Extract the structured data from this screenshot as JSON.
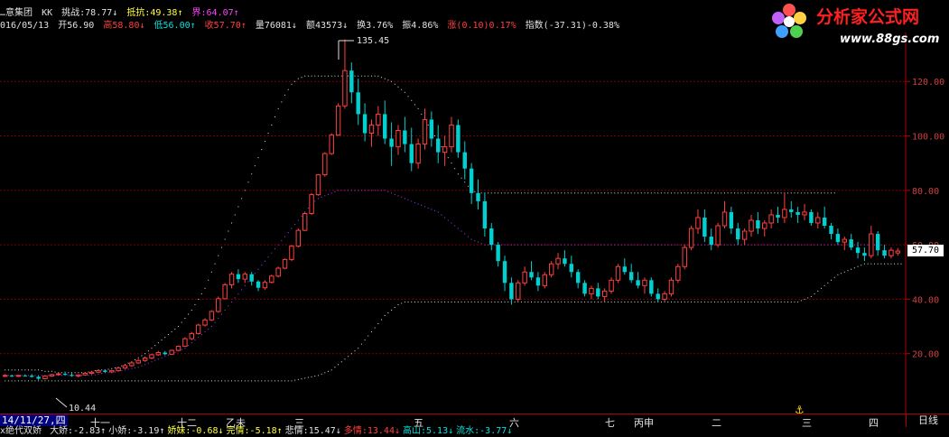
{
  "header": {
    "stock_name": "…意集团",
    "indicator_name": "KK",
    "tiaozhan": "挑战:78.77↓",
    "kangli": "抵抗:49.38↑",
    "jie": "界:64.07↑",
    "date": "016/05/13",
    "open": "开56.90",
    "high": "高58.80↓",
    "low": "低56.00↑",
    "close": "收57.70↑",
    "volume": "量76081↓",
    "amount": "额43573↓",
    "turnover": "换3.76%",
    "amplitude": "振4.86%",
    "change": "涨(0.10)0.17%",
    "index": "指数(-37.31)-0.38%"
  },
  "watermark": {
    "brand": "分析家公式网",
    "url": "www.88gs.com",
    "colors": {
      "brand": "#ff2020",
      "url": "#ffffff"
    }
  },
  "annotations": {
    "peak": "135.45",
    "trough": "10.44",
    "current_price": "57.70"
  },
  "y_axis": {
    "labels": [
      "120.00",
      "100.00",
      "80.00",
      "60.00",
      "40.00",
      "20.00"
    ]
  },
  "time_axis": {
    "date_box": "14/11/27,四",
    "labels": [
      "十一",
      "十二",
      "乙未",
      "三",
      "五",
      "六",
      "七",
      "丙申",
      "二",
      "三",
      "四"
    ],
    "period_button": "日线"
  },
  "footer": {
    "prefix": "x绝代双娇",
    "items": [
      {
        "label": "大娇:-2.83↑",
        "color": "#e0e0e0"
      },
      {
        "label": "小娇:-3.19↑",
        "color": "#e0e0e0"
      },
      {
        "label": "娇妹:-0.68↓",
        "color": "#ffff40"
      },
      {
        "label": "完情:-5.18↑",
        "color": "#ffff40"
      },
      {
        "label": "悲情:15.47↓",
        "color": "#e0e0e0"
      },
      {
        "label": "多情:13.44↓",
        "color": "#ff4040"
      },
      {
        "label": "高山:5.13↓",
        "color": "#00e0e0"
      },
      {
        "label": "流水:-3.77↓",
        "color": "#00e0e0"
      }
    ]
  },
  "chart_data": {
    "type": "candlestick",
    "ylim": [
      0,
      135
    ],
    "gridlines": [
      20,
      40,
      60,
      80,
      100,
      120
    ],
    "candles": [
      [
        12,
        12.5,
        11.5,
        12
      ],
      [
        12,
        12.3,
        11.4,
        11.8
      ],
      [
        11.8,
        12.2,
        11.5,
        12
      ],
      [
        12,
        12.4,
        11.6,
        11.9
      ],
      [
        11.9,
        12.5,
        11.2,
        11.5
      ],
      [
        11.5,
        11.8,
        10.4,
        10.8
      ],
      [
        10.8,
        12,
        10.6,
        11.8
      ],
      [
        11.8,
        12.6,
        11.5,
        12.3
      ],
      [
        12.3,
        13,
        12,
        12.6
      ],
      [
        12.6,
        13.4,
        12.2,
        12.2
      ],
      [
        12.2,
        12.8,
        11.5,
        11.8
      ],
      [
        11.8,
        12.4,
        11.3,
        12.2
      ],
      [
        12.2,
        13,
        12,
        12.8
      ],
      [
        12.8,
        13.6,
        12.4,
        13.2
      ],
      [
        13.2,
        14,
        12.9,
        13.8
      ],
      [
        13.8,
        14.2,
        13,
        13.3
      ],
      [
        13.3,
        14,
        13,
        13.8
      ],
      [
        13.8,
        15,
        13.6,
        14.7
      ],
      [
        14.7,
        16,
        14.4,
        15.6
      ],
      [
        15.6,
        17,
        15.2,
        16.6
      ],
      [
        16.6,
        18,
        16.2,
        17.5
      ],
      [
        17.5,
        19,
        17,
        18.4
      ],
      [
        18.4,
        20,
        18,
        19.6
      ],
      [
        19.6,
        21,
        19.2,
        20.4
      ],
      [
        20.4,
        21,
        19.4,
        19.8
      ],
      [
        19.8,
        21.5,
        19.5,
        21.2
      ],
      [
        21.2,
        23,
        21,
        22.7
      ],
      [
        22.7,
        26,
        22.5,
        25.5
      ],
      [
        25.5,
        28,
        25,
        27.4
      ],
      [
        27.4,
        31,
        27,
        30.5
      ],
      [
        30.5,
        33,
        30,
        32.4
      ],
      [
        32.4,
        36,
        32,
        35.5
      ],
      [
        35.5,
        41,
        35,
        40.2
      ],
      [
        40.2,
        46,
        40,
        45.3
      ],
      [
        45.3,
        50,
        44,
        49.2
      ],
      [
        49.2,
        51,
        46,
        47.4
      ],
      [
        47.4,
        50,
        46,
        49.2
      ],
      [
        49.2,
        50,
        45,
        46.5
      ],
      [
        46.5,
        47,
        43,
        44.2
      ],
      [
        44.2,
        47,
        43.5,
        46.2
      ],
      [
        46.2,
        49,
        45.8,
        48.5
      ],
      [
        48.5,
        52,
        48,
        51.4
      ],
      [
        51.4,
        55,
        51,
        54.6
      ],
      [
        54.6,
        60,
        54,
        59.5
      ],
      [
        59.5,
        66,
        59,
        65.3
      ],
      [
        65.3,
        72,
        65,
        71.5
      ],
      [
        71.5,
        79,
        71,
        78.4
      ],
      [
        78.4,
        86,
        78,
        85.7
      ],
      [
        85.7,
        94,
        85,
        93.5
      ],
      [
        93.5,
        101,
        93,
        100.3
      ],
      [
        100.3,
        112,
        100,
        111
      ],
      [
        111,
        135.45,
        110,
        124
      ],
      [
        124,
        127,
        112,
        116
      ],
      [
        116,
        121,
        104,
        108
      ],
      [
        108,
        112,
        98,
        101
      ],
      [
        101,
        106,
        96,
        104
      ],
      [
        104,
        111,
        100,
        108
      ],
      [
        108,
        113,
        97,
        99
      ],
      [
        99,
        105,
        89,
        96
      ],
      [
        96,
        104,
        93,
        102
      ],
      [
        102,
        107,
        94,
        97
      ],
      [
        97,
        103,
        87,
        90
      ],
      [
        90,
        99,
        88,
        97
      ],
      [
        97,
        110,
        95,
        106
      ],
      [
        106,
        109,
        96,
        99
      ],
      [
        99,
        104,
        90,
        94
      ],
      [
        94,
        100,
        89,
        96
      ],
      [
        96,
        107,
        94,
        104
      ],
      [
        104,
        106,
        92,
        94
      ],
      [
        94,
        98,
        84,
        88
      ],
      [
        88,
        90,
        75,
        79
      ],
      [
        79,
        84,
        73,
        76
      ],
      [
        76,
        79,
        63,
        66
      ],
      [
        66,
        68,
        58,
        60
      ],
      [
        60,
        61,
        52,
        54
      ],
      [
        54,
        56,
        43,
        46
      ],
      [
        46,
        48,
        38,
        40
      ],
      [
        40,
        47,
        39,
        46
      ],
      [
        46,
        52,
        45,
        50
      ],
      [
        50,
        54,
        47,
        48
      ],
      [
        48,
        50,
        43,
        45
      ],
      [
        45,
        50,
        44,
        49
      ],
      [
        49,
        54,
        48,
        53
      ],
      [
        53,
        57,
        51,
        55
      ],
      [
        55,
        58,
        52,
        53
      ],
      [
        53,
        56,
        48,
        50
      ],
      [
        50,
        51,
        44,
        46
      ],
      [
        46,
        47,
        41,
        42
      ],
      [
        42,
        45,
        40,
        44
      ],
      [
        44,
        46,
        40,
        41
      ],
      [
        41,
        44,
        39,
        43
      ],
      [
        43,
        48,
        42,
        47
      ],
      [
        47,
        53,
        46,
        52
      ],
      [
        52,
        55,
        49,
        50
      ],
      [
        50,
        53,
        46,
        47
      ],
      [
        47,
        50,
        44,
        45
      ],
      [
        45,
        48,
        42,
        47
      ],
      [
        47,
        48,
        41,
        42
      ],
      [
        42,
        44,
        39,
        40
      ],
      [
        40,
        43,
        39,
        42
      ],
      [
        42,
        48,
        41,
        47
      ],
      [
        47,
        53,
        46,
        52
      ],
      [
        52,
        60,
        51,
        59
      ],
      [
        59,
        67,
        58,
        66
      ],
      [
        66,
        73,
        64,
        70
      ],
      [
        70,
        73,
        61,
        63
      ],
      [
        63,
        66,
        58,
        60
      ],
      [
        60,
        68,
        59,
        67
      ],
      [
        67,
        76,
        66,
        72
      ],
      [
        72,
        74,
        64,
        66
      ],
      [
        66,
        68,
        60,
        62
      ],
      [
        62,
        66,
        60,
        65
      ],
      [
        65,
        71,
        63,
        69
      ],
      [
        69,
        72,
        64,
        66
      ],
      [
        66,
        69,
        63,
        68
      ],
      [
        68,
        73,
        66,
        71
      ],
      [
        71,
        74,
        68,
        70
      ],
      [
        70,
        79,
        68,
        73
      ],
      [
        73,
        76,
        70,
        72
      ],
      [
        72,
        74,
        68,
        71
      ],
      [
        71,
        75,
        69,
        72
      ],
      [
        72,
        73,
        67,
        68
      ],
      [
        68,
        72,
        66,
        70
      ],
      [
        70,
        74,
        66,
        67
      ],
      [
        67,
        68,
        62,
        64
      ],
      [
        64,
        66,
        60,
        61
      ],
      [
        61,
        63,
        58,
        62
      ],
      [
        62,
        64,
        58,
        59
      ],
      [
        59,
        61,
        55,
        57
      ],
      [
        57,
        59,
        54,
        56
      ],
      [
        56,
        67,
        55,
        64
      ],
      [
        64,
        65,
        56,
        58
      ],
      [
        58,
        60,
        55,
        56
      ],
      [
        56,
        59,
        55,
        58
      ],
      [
        57,
        58.8,
        56,
        57.7
      ]
    ],
    "upper_band": [
      14,
      14,
      14,
      14,
      14,
      14,
      13.5,
      13.5,
      13,
      13,
      13,
      13,
      13,
      13.5,
      14,
      14,
      14.5,
      15,
      16,
      17,
      18.5,
      20,
      22,
      24,
      26,
      28,
      30,
      33,
      36,
      40,
      44,
      50,
      56,
      62,
      68,
      74,
      80,
      86,
      92,
      98,
      104,
      110,
      115,
      119,
      121,
      122,
      122,
      122,
      122,
      122,
      122,
      122,
      122,
      122,
      122,
      122,
      122,
      121,
      120,
      118,
      116,
      113,
      110,
      106,
      102,
      98,
      94,
      90,
      86,
      83,
      80,
      79,
      79,
      79,
      79,
      79,
      79,
      79,
      79,
      79,
      79,
      79,
      79,
      79,
      79,
      79,
      79,
      79,
      79,
      79,
      79,
      79,
      79,
      79,
      79,
      79,
      79,
      79,
      79,
      79,
      79,
      79,
      79,
      79,
      79,
      79,
      79,
      79,
      79,
      79,
      79,
      79,
      79,
      79,
      79,
      79,
      79,
      79,
      79,
      79,
      79,
      79,
      79,
      79,
      79
    ],
    "mid_band": [
      12,
      12,
      12,
      12,
      12,
      12,
      12,
      12,
      12,
      12,
      12,
      12,
      12,
      12,
      12.5,
      13,
      13,
      13.5,
      14,
      14.5,
      15,
      16,
      17,
      18,
      19,
      20,
      21,
      22,
      24,
      26,
      28,
      30,
      33,
      36,
      39,
      42,
      45,
      48,
      51,
      54,
      57,
      60,
      63,
      66,
      69,
      72,
      75,
      77,
      78,
      79,
      80,
      80,
      80,
      80,
      80,
      80,
      80,
      80,
      79,
      78,
      77,
      76,
      75,
      74,
      73,
      72,
      70,
      68,
      66,
      64,
      62,
      61,
      60,
      60,
      60,
      60,
      60,
      60,
      60,
      60,
      60,
      60,
      60,
      60,
      60,
      60,
      60,
      60,
      60,
      60,
      60,
      60,
      60,
      60,
      60,
      60,
      60,
      60,
      60,
      60,
      60,
      60,
      60,
      60,
      60,
      60,
      60,
      60,
      60,
      60,
      60,
      60,
      60,
      60,
      60,
      60,
      60,
      60,
      60,
      60,
      60,
      60,
      60,
      60,
      60,
      60,
      60,
      60,
      60,
      60,
      60,
      60
    ],
    "lower_band": [
      10,
      10,
      10,
      10,
      10,
      10,
      10,
      10,
      10,
      10,
      10,
      10,
      10,
      10,
      10,
      10,
      10,
      10,
      10,
      10,
      10,
      10,
      10,
      10,
      10,
      10,
      10,
      10,
      10,
      10,
      10,
      10,
      10,
      10,
      10,
      10,
      10,
      10,
      10,
      10,
      10,
      10,
      10,
      10,
      10.5,
      11,
      11.5,
      12,
      13,
      14,
      16,
      18,
      20,
      22,
      25,
      28,
      31,
      34,
      36,
      38,
      39,
      39,
      39,
      39,
      39,
      39,
      39,
      39,
      39,
      39,
      39,
      39,
      39,
      39,
      39,
      39,
      39,
      39,
      39,
      39,
      39,
      39,
      39,
      39,
      39,
      39,
      39,
      39,
      39,
      39,
      39,
      39,
      39,
      39,
      39,
      39,
      39,
      39,
      39,
      39,
      39,
      39,
      39,
      39,
      39,
      39,
      39,
      39,
      39,
      39,
      39,
      39,
      39,
      39,
      39,
      39,
      39,
      39,
      39,
      39,
      40,
      41,
      43,
      45,
      47,
      49,
      50,
      51,
      52,
      53,
      53,
      53,
      53,
      53,
      53
    ]
  }
}
